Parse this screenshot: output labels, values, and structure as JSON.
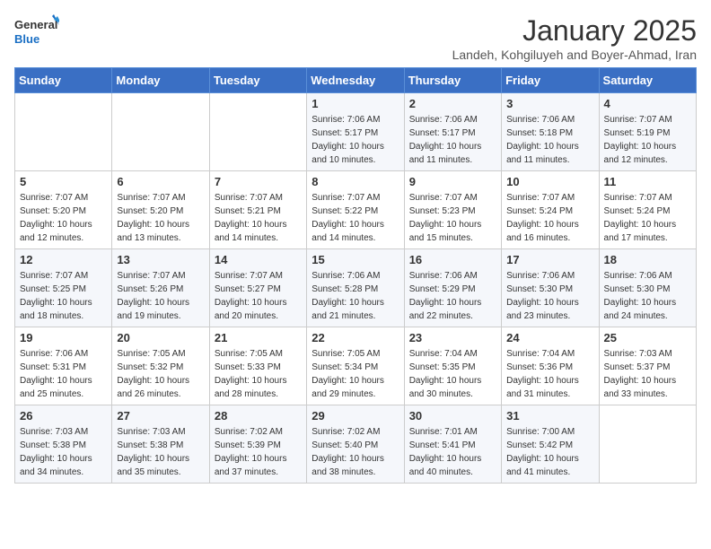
{
  "header": {
    "logo_line1": "General",
    "logo_line2": "Blue",
    "month": "January 2025",
    "location": "Landeh, Kohgiluyeh and Boyer-Ahmad, Iran"
  },
  "days_of_week": [
    "Sunday",
    "Monday",
    "Tuesday",
    "Wednesday",
    "Thursday",
    "Friday",
    "Saturday"
  ],
  "weeks": [
    [
      {
        "day": "",
        "sunrise": "",
        "sunset": "",
        "daylight": ""
      },
      {
        "day": "",
        "sunrise": "",
        "sunset": "",
        "daylight": ""
      },
      {
        "day": "",
        "sunrise": "",
        "sunset": "",
        "daylight": ""
      },
      {
        "day": "1",
        "sunrise": "Sunrise: 7:06 AM",
        "sunset": "Sunset: 5:17 PM",
        "daylight": "Daylight: 10 hours and 10 minutes."
      },
      {
        "day": "2",
        "sunrise": "Sunrise: 7:06 AM",
        "sunset": "Sunset: 5:17 PM",
        "daylight": "Daylight: 10 hours and 11 minutes."
      },
      {
        "day": "3",
        "sunrise": "Sunrise: 7:06 AM",
        "sunset": "Sunset: 5:18 PM",
        "daylight": "Daylight: 10 hours and 11 minutes."
      },
      {
        "day": "4",
        "sunrise": "Sunrise: 7:07 AM",
        "sunset": "Sunset: 5:19 PM",
        "daylight": "Daylight: 10 hours and 12 minutes."
      }
    ],
    [
      {
        "day": "5",
        "sunrise": "Sunrise: 7:07 AM",
        "sunset": "Sunset: 5:20 PM",
        "daylight": "Daylight: 10 hours and 12 minutes."
      },
      {
        "day": "6",
        "sunrise": "Sunrise: 7:07 AM",
        "sunset": "Sunset: 5:20 PM",
        "daylight": "Daylight: 10 hours and 13 minutes."
      },
      {
        "day": "7",
        "sunrise": "Sunrise: 7:07 AM",
        "sunset": "Sunset: 5:21 PM",
        "daylight": "Daylight: 10 hours and 14 minutes."
      },
      {
        "day": "8",
        "sunrise": "Sunrise: 7:07 AM",
        "sunset": "Sunset: 5:22 PM",
        "daylight": "Daylight: 10 hours and 14 minutes."
      },
      {
        "day": "9",
        "sunrise": "Sunrise: 7:07 AM",
        "sunset": "Sunset: 5:23 PM",
        "daylight": "Daylight: 10 hours and 15 minutes."
      },
      {
        "day": "10",
        "sunrise": "Sunrise: 7:07 AM",
        "sunset": "Sunset: 5:24 PM",
        "daylight": "Daylight: 10 hours and 16 minutes."
      },
      {
        "day": "11",
        "sunrise": "Sunrise: 7:07 AM",
        "sunset": "Sunset: 5:24 PM",
        "daylight": "Daylight: 10 hours and 17 minutes."
      }
    ],
    [
      {
        "day": "12",
        "sunrise": "Sunrise: 7:07 AM",
        "sunset": "Sunset: 5:25 PM",
        "daylight": "Daylight: 10 hours and 18 minutes."
      },
      {
        "day": "13",
        "sunrise": "Sunrise: 7:07 AM",
        "sunset": "Sunset: 5:26 PM",
        "daylight": "Daylight: 10 hours and 19 minutes."
      },
      {
        "day": "14",
        "sunrise": "Sunrise: 7:07 AM",
        "sunset": "Sunset: 5:27 PM",
        "daylight": "Daylight: 10 hours and 20 minutes."
      },
      {
        "day": "15",
        "sunrise": "Sunrise: 7:06 AM",
        "sunset": "Sunset: 5:28 PM",
        "daylight": "Daylight: 10 hours and 21 minutes."
      },
      {
        "day": "16",
        "sunrise": "Sunrise: 7:06 AM",
        "sunset": "Sunset: 5:29 PM",
        "daylight": "Daylight: 10 hours and 22 minutes."
      },
      {
        "day": "17",
        "sunrise": "Sunrise: 7:06 AM",
        "sunset": "Sunset: 5:30 PM",
        "daylight": "Daylight: 10 hours and 23 minutes."
      },
      {
        "day": "18",
        "sunrise": "Sunrise: 7:06 AM",
        "sunset": "Sunset: 5:30 PM",
        "daylight": "Daylight: 10 hours and 24 minutes."
      }
    ],
    [
      {
        "day": "19",
        "sunrise": "Sunrise: 7:06 AM",
        "sunset": "Sunset: 5:31 PM",
        "daylight": "Daylight: 10 hours and 25 minutes."
      },
      {
        "day": "20",
        "sunrise": "Sunrise: 7:05 AM",
        "sunset": "Sunset: 5:32 PM",
        "daylight": "Daylight: 10 hours and 26 minutes."
      },
      {
        "day": "21",
        "sunrise": "Sunrise: 7:05 AM",
        "sunset": "Sunset: 5:33 PM",
        "daylight": "Daylight: 10 hours and 28 minutes."
      },
      {
        "day": "22",
        "sunrise": "Sunrise: 7:05 AM",
        "sunset": "Sunset: 5:34 PM",
        "daylight": "Daylight: 10 hours and 29 minutes."
      },
      {
        "day": "23",
        "sunrise": "Sunrise: 7:04 AM",
        "sunset": "Sunset: 5:35 PM",
        "daylight": "Daylight: 10 hours and 30 minutes."
      },
      {
        "day": "24",
        "sunrise": "Sunrise: 7:04 AM",
        "sunset": "Sunset: 5:36 PM",
        "daylight": "Daylight: 10 hours and 31 minutes."
      },
      {
        "day": "25",
        "sunrise": "Sunrise: 7:03 AM",
        "sunset": "Sunset: 5:37 PM",
        "daylight": "Daylight: 10 hours and 33 minutes."
      }
    ],
    [
      {
        "day": "26",
        "sunrise": "Sunrise: 7:03 AM",
        "sunset": "Sunset: 5:38 PM",
        "daylight": "Daylight: 10 hours and 34 minutes."
      },
      {
        "day": "27",
        "sunrise": "Sunrise: 7:03 AM",
        "sunset": "Sunset: 5:38 PM",
        "daylight": "Daylight: 10 hours and 35 minutes."
      },
      {
        "day": "28",
        "sunrise": "Sunrise: 7:02 AM",
        "sunset": "Sunset: 5:39 PM",
        "daylight": "Daylight: 10 hours and 37 minutes."
      },
      {
        "day": "29",
        "sunrise": "Sunrise: 7:02 AM",
        "sunset": "Sunset: 5:40 PM",
        "daylight": "Daylight: 10 hours and 38 minutes."
      },
      {
        "day": "30",
        "sunrise": "Sunrise: 7:01 AM",
        "sunset": "Sunset: 5:41 PM",
        "daylight": "Daylight: 10 hours and 40 minutes."
      },
      {
        "day": "31",
        "sunrise": "Sunrise: 7:00 AM",
        "sunset": "Sunset: 5:42 PM",
        "daylight": "Daylight: 10 hours and 41 minutes."
      },
      {
        "day": "",
        "sunrise": "",
        "sunset": "",
        "daylight": ""
      }
    ]
  ]
}
